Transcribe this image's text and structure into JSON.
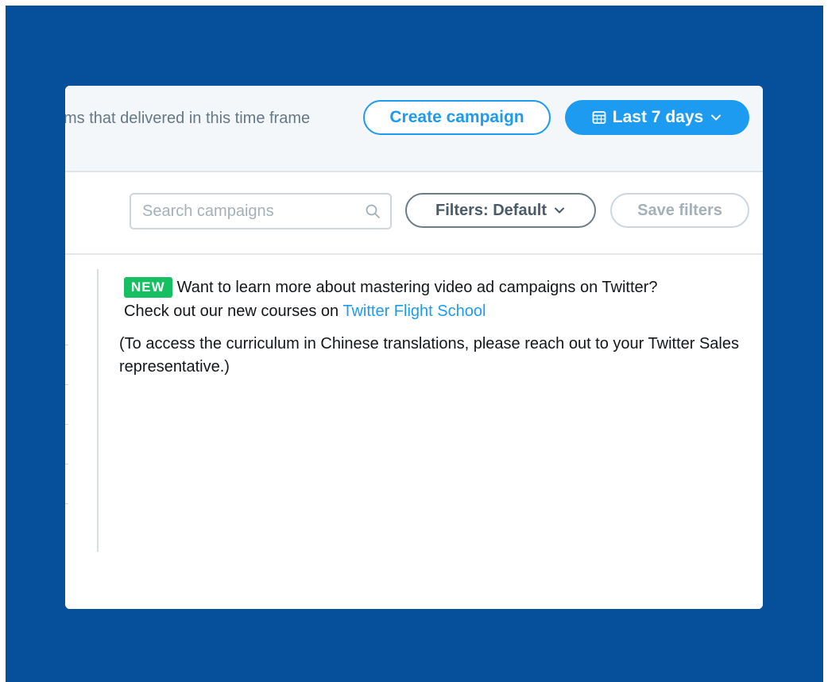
{
  "header": {
    "note": "ms that delivered in this time frame",
    "create_label": "Create campaign",
    "range_label": "Last 7 days"
  },
  "toolbar": {
    "search_placeholder": "Search campaigns",
    "filters_label": "Filters: Default",
    "save_filters_label": "Save filters"
  },
  "announcement": {
    "badge": "NEW",
    "line1": "Want to learn more about mastering video ad campaigns on Twitter?",
    "line2_prefix": "Check out our new courses on ",
    "link_text": "Twitter Flight School",
    "note": "(To access the curriculum in Chinese translations, please reach out to your Twitter Sales representative.)"
  },
  "colors": {
    "background": "#064f9b",
    "accent": "#1d9bf0",
    "badge": "#17bf63"
  },
  "icons": [
    "calendar-icon",
    "chevron-down-icon",
    "search-icon"
  ]
}
